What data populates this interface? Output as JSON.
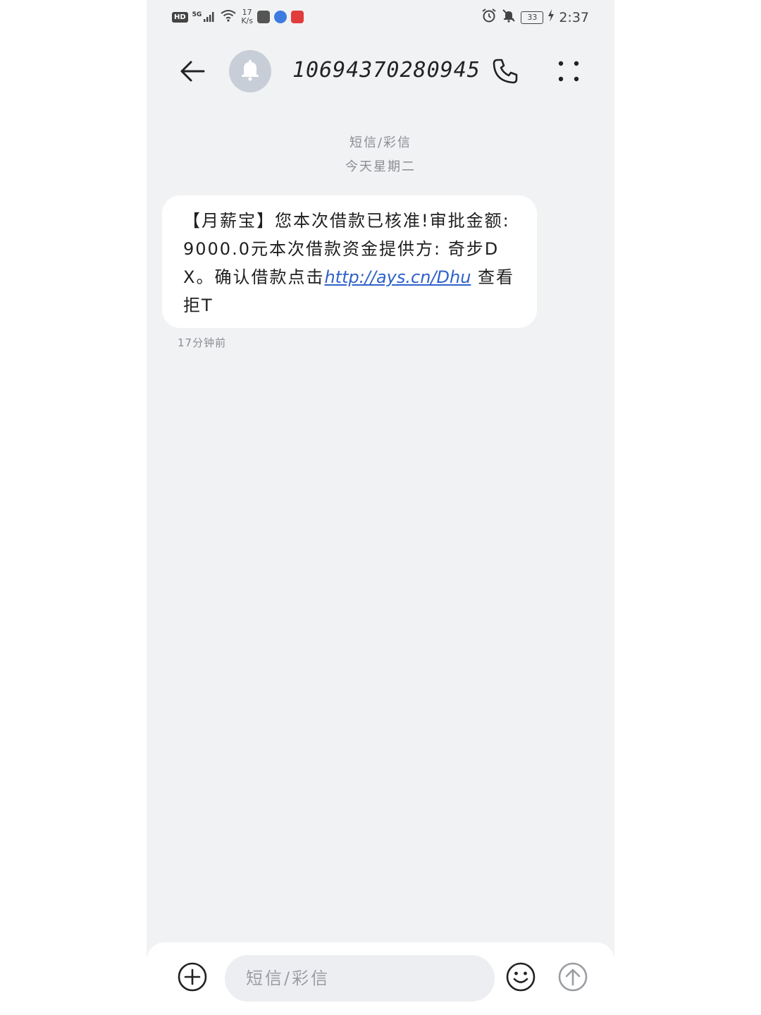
{
  "status_bar": {
    "hd_label": "HD",
    "network_label": "5G",
    "net_speed_value": "17",
    "net_speed_unit": "K/s",
    "battery_level": "33",
    "time": "2:37"
  },
  "header": {
    "contact_number": "10694370280945"
  },
  "thread": {
    "channel_label": "短信/彩信",
    "date_label": "今天星期二"
  },
  "message": {
    "text_before_link": "【月薪宝】您本次借款已核准!审批金额: 9000.0元本次借款资金提供方: 奇步DX。确认借款点击",
    "link": "http://ays.cn/Dhu",
    "text_after_link": " 查看拒T",
    "time": "17分钟前"
  },
  "composer": {
    "placeholder": "短信/彩信"
  },
  "colors": {
    "background": "#f1f2f4",
    "bubble": "#ffffff",
    "link": "#2f62c9",
    "muted_text": "#8a8d93"
  },
  "icons": {
    "back": "arrow-left-icon",
    "avatar": "bell-icon",
    "call": "phone-icon",
    "more": "more-dots-icon",
    "attach": "plus-circle-icon",
    "emoji": "smiley-icon",
    "send": "send-arrow-icon"
  }
}
